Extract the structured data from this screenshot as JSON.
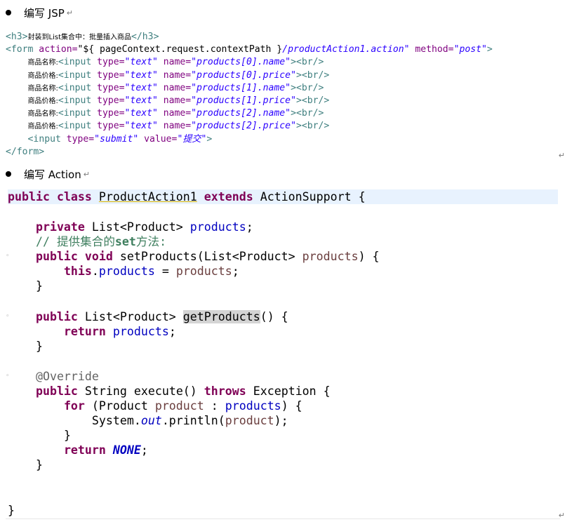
{
  "sections": {
    "jsp_heading": "编写 JSP",
    "action_heading": "编写 Action"
  },
  "jsp": {
    "h3_open": "<h3>",
    "h3_text": "封装到List集合中：批量插入商品",
    "h3_close": "</h3>",
    "form_open": "<form",
    "form_action_attr": " action=",
    "form_action_val_a": "\"${ pageContext.request.contextPath }",
    "form_action_val_b": "/productAction1.action\"",
    "form_method_attr": " method=",
    "form_method_val": "\"post\"",
    "form_gt": ">",
    "label_name": "商品名称:",
    "label_price": "商品价格:",
    "input_open": "<input",
    "type_attr": " type=",
    "text_val": "\"text\"",
    "name_attr": " name=",
    "br": "><br/>",
    "names": [
      "\"products[0].name\"",
      "\"products[0].price\"",
      "\"products[1].name\"",
      "\"products[1].price\"",
      "\"products[2].name\"",
      "\"products[2].price\""
    ],
    "submit_type_val": "\"submit\"",
    "value_attr": " value=",
    "submit_val": "\"提交\"",
    "submit_gt": ">",
    "form_close": "</form>"
  },
  "java": {
    "public": "public",
    "class": "class",
    "extends": "extends",
    "private": "private",
    "void": "void",
    "this": "this",
    "return": "return",
    "throws": "throws",
    "for": "for",
    "class_name": "ProductAction1",
    "super_name": "ActionSupport",
    "open_brace": " {",
    "close_brace": "}",
    "list_product": "List<Product>",
    "products": "products",
    "semi": ";",
    "comment_a": "// 提供集合的",
    "comment_b": "set",
    "comment_c": "方法:",
    "set_method": "setProducts(List<Product> ",
    "sig_close": ") {",
    "dot": ".",
    "assign": " = ",
    "get_method": "getProducts",
    "parens": "()",
    "override": "@Override",
    "string": "String",
    "execute": "execute()",
    "exception": "Exception",
    "for_open": " (Product ",
    "product": "product",
    "colon": " : ",
    "system": "System.",
    "out": "out",
    "println": ".println(",
    "println_close": ");",
    "none": "NONE"
  }
}
